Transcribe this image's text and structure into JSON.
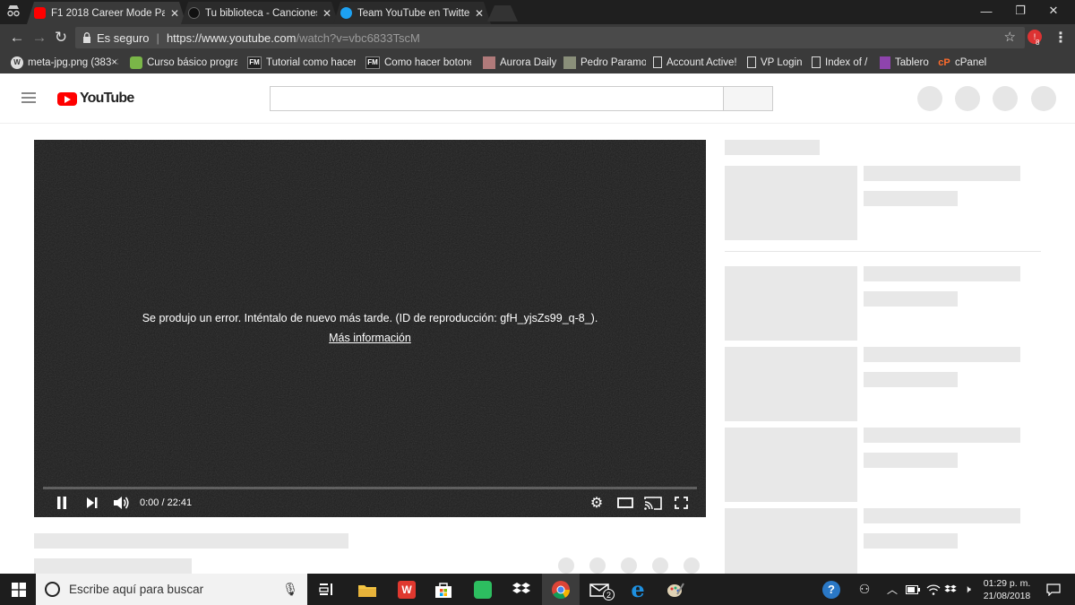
{
  "browser": {
    "tabs": [
      {
        "title": "F1 2018 Career Mode Par",
        "icon": "youtube-favicon",
        "color": "#ff0000"
      },
      {
        "title": "Tu biblioteca - Canciones",
        "icon": "spotify-favicon",
        "color": "#1a1a1a"
      },
      {
        "title": "Team YouTube en Twitter",
        "icon": "twitter-favicon",
        "color": "#1da1f2"
      }
    ],
    "close_glyph": "✕",
    "secure_label": "Es seguro",
    "url_main": "https://www.youtube.com",
    "url_path": "/watch?v=vbc6833TscM",
    "extension_badge": "8"
  },
  "bookmarks": [
    {
      "label": "meta-jpg.png (383×3",
      "icon": "wordpress-icon"
    },
    {
      "label": "Curso básico progran",
      "icon": "android-icon"
    },
    {
      "label": "Tutorial como hacer",
      "icon": "fm-icon"
    },
    {
      "label": "Como hacer botones",
      "icon": "fm-icon"
    },
    {
      "label": "Aurora Daily",
      "icon": "image-icon"
    },
    {
      "label": "Pedro Paramo",
      "icon": "image-icon"
    },
    {
      "label": "Account Active!",
      "icon": "page-icon"
    },
    {
      "label": "VP Login",
      "icon": "page-icon"
    },
    {
      "label": "Index of /",
      "icon": "page-icon"
    },
    {
      "label": "Tablero",
      "icon": "twitch-icon"
    },
    {
      "label": "cPanel",
      "icon": "cpanel-icon"
    }
  ],
  "youtube": {
    "logo_text": "YouTube",
    "brand_color": "#ff0000"
  },
  "player": {
    "error_message": "Se produjo un error. Inténtalo de nuevo más tarde. (ID de reproducción: gfH_yjsZs99_q-8_).",
    "more_info": "Más información",
    "time": "0:00 / 22:41"
  },
  "taskbar": {
    "search_placeholder": "Escribe aquí para buscar",
    "mail_badge": "2",
    "clock_time": "01:29 p. m.",
    "clock_date": "21/08/2018"
  }
}
